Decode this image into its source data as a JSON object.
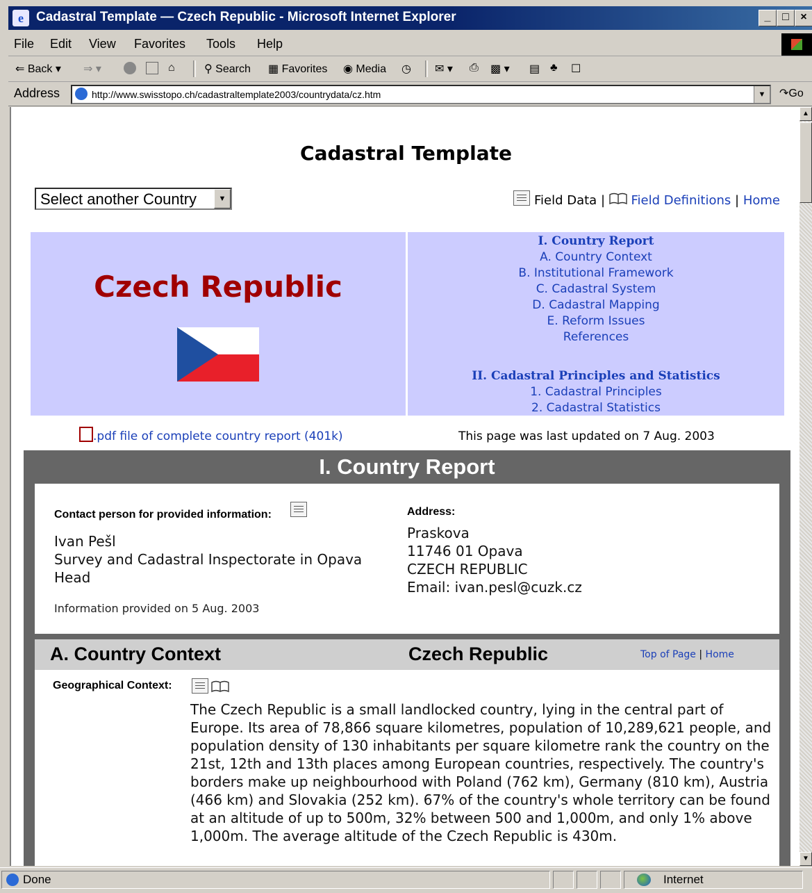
{
  "window": {
    "title": "Cadastral Template — Czech Republic - Microsoft Internet Explorer",
    "min": "_",
    "max": "□",
    "close": "×"
  },
  "menu": {
    "items": [
      "File",
      "Edit",
      "View",
      "Favorites",
      "Tools",
      "Help"
    ]
  },
  "toolbar": {
    "back": "Back",
    "search": "Search",
    "favorites": "Favorites",
    "media": "Media"
  },
  "address": {
    "label": "Address",
    "url": "http://www.swisstopo.ch/cadastraltemplate2003/countrydata/cz.htm",
    "go": "Go"
  },
  "page": {
    "title": "Cadastral Template",
    "country_select": "Select another Country",
    "links": {
      "field_data": "Field Data",
      "field_definitions": "Field Definitions",
      "home": "Home",
      "separator": "|"
    },
    "country": "Czech Republic",
    "toc": {
      "part1_heading": "I. Country Report",
      "part1_items": [
        "A. Country Context",
        "B. Institutional Framework",
        "C. Cadastral System",
        "D. Cadastral Mapping",
        "E. Reform Issues",
        "References"
      ],
      "part2_heading": "II. Cadastral Principles and Statistics",
      "part2_items": [
        "1. Cadastral Principles",
        "2. Cadastral Statistics"
      ]
    },
    "pdf_link": ".pdf file of complete country report (401k)",
    "updated": "This page was last updated on 7 Aug. 2003",
    "report": {
      "title": "I. Country Report",
      "contact_label": "Contact person for provided information:",
      "contact_lines": [
        "Ivan Pešl",
        "Survey and Cadastral Inspectorate in Opava",
        "Head"
      ],
      "provided": "Information provided on 5 Aug. 2003",
      "address_label": "Address:",
      "address_lines": [
        "Praskova",
        "11746 01 Opava",
        "CZECH REPUBLIC",
        "Email: ivan.pesl@cuzk.cz"
      ]
    },
    "section": {
      "title": "A. Country Context",
      "country": "Czech Republic",
      "top_of_page": "Top of Page",
      "home": "Home",
      "separator": "|",
      "geo_label": "Geographical Context:",
      "geo_text": "The Czech Republic is a small landlocked country, lying in the central part of Europe. Its area of 78,866 square kilometres, population of 10,289,621 people, and population density of 130 inhabitants per square kilometre rank the country on the 21st, 12th and 13th places among European countries, respectively. The country's borders make up neighbourhood with Poland (762 km), Germany (810 km), Austria (466 km) and Slovakia (252 km). 67% of the country's whole territory can be found at an altitude of up to 500m, 32% between 500 and 1,000m, and only 1% above 1,000m. The average altitude of the Czech Republic is 430m."
    }
  },
  "status": {
    "text": "Done",
    "zone": "Internet"
  },
  "colors": {
    "title_bar": "#0a246a",
    "panel_bg": "#ccccff",
    "link": "#1a3fb8",
    "country_red": "#a00000",
    "frame_gray": "#666666"
  }
}
